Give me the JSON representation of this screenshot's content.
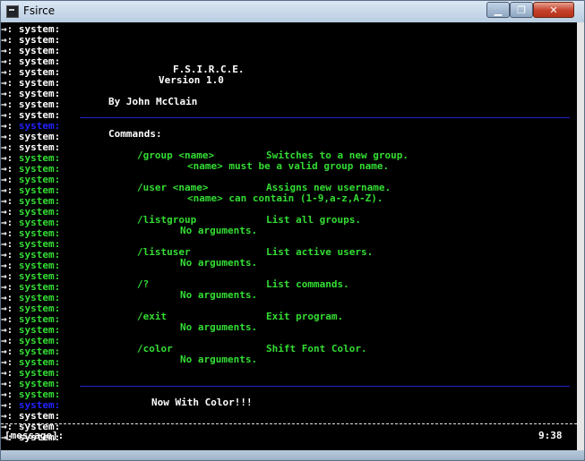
{
  "window": {
    "title": "Fsirce",
    "controls": {
      "minimize": "▁",
      "maximize": "❐",
      "close": "✕"
    },
    "icon": "console-app-icon"
  },
  "console": {
    "prefix": "→: ",
    "sys_label": "system:",
    "lines_count_note": "",
    "colors": {
      "white": "#ffffff",
      "green": "#33dd33",
      "blue": "#2222ff"
    },
    "header": {
      "title": "F.S.I.R.C.E.",
      "version": "Version 1.0",
      "author": "By John McClain"
    },
    "commands_heading": "Commands:",
    "commands": [
      {
        "cmd": "/group <name>",
        "desc": "Switches to a new group.",
        "detail": "<name> must be a valid group name."
      },
      {
        "cmd": "/user <name>",
        "desc": "Assigns new username.",
        "detail": "<name> can contain (1-9,a-z,A-Z)."
      },
      {
        "cmd": "/listgroup",
        "desc": "List all groups.",
        "detail": "No arguments."
      },
      {
        "cmd": "/listuser",
        "desc": "List active users.",
        "detail": "No arguments."
      },
      {
        "cmd": "/?",
        "desc": "List commands.",
        "detail": "No arguments."
      },
      {
        "cmd": "/exit",
        "desc": "Exit program.",
        "detail": "No arguments."
      },
      {
        "cmd": "/color",
        "desc": "Shift Font Color.",
        "detail": "No arguments."
      }
    ],
    "footer_text": "Now With Color!!!"
  },
  "input": {
    "label": "[message]:",
    "value": "",
    "clock": "9:38"
  }
}
